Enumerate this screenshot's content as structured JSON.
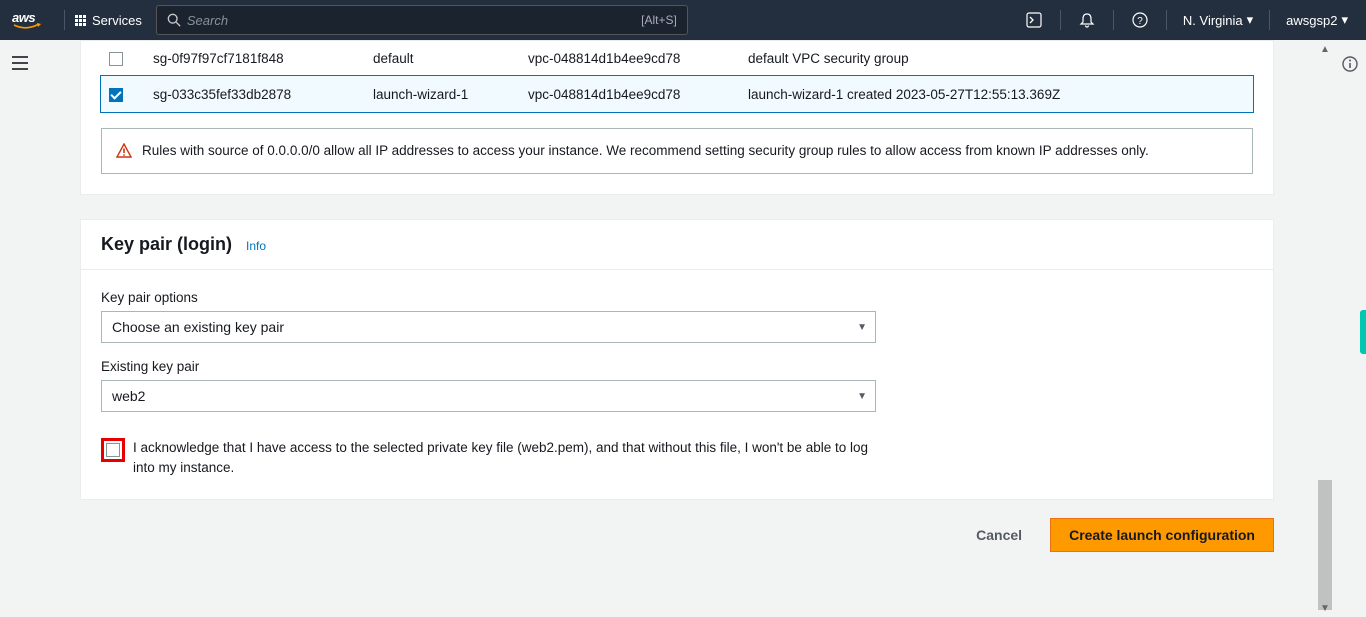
{
  "nav": {
    "logo_text": "aws",
    "services_label": "Services",
    "search_placeholder": "Search",
    "search_hint": "[Alt+S]",
    "region": "N. Virginia",
    "username": "awsgsp2"
  },
  "security_groups": {
    "rows": [
      {
        "checked": false,
        "sg_id": "sg-0f97f97cf7181f848",
        "name": "default",
        "vpc": "vpc-048814d1b4ee9cd78",
        "desc": "default VPC security group"
      },
      {
        "checked": true,
        "sg_id": "sg-033c35fef33db2878",
        "name": "launch-wizard-1",
        "vpc": "vpc-048814d1b4ee9cd78",
        "desc": "launch-wizard-1 created 2023-05-27T12:55:13.369Z"
      }
    ],
    "warning": "Rules with source of 0.0.0.0/0 allow all IP addresses to access your instance. We recommend setting security group rules to allow access from known IP addresses only."
  },
  "key_pair": {
    "title": "Key pair (login)",
    "info": "Info",
    "options_label": "Key pair options",
    "options_value": "Choose an existing key pair",
    "existing_label": "Existing key pair",
    "existing_value": "web2",
    "ack_text": "I acknowledge that I have access to the selected private key file (web2.pem), and that without this file, I won't be able to log into my instance."
  },
  "footer": {
    "cancel": "Cancel",
    "create": "Create launch configuration"
  }
}
